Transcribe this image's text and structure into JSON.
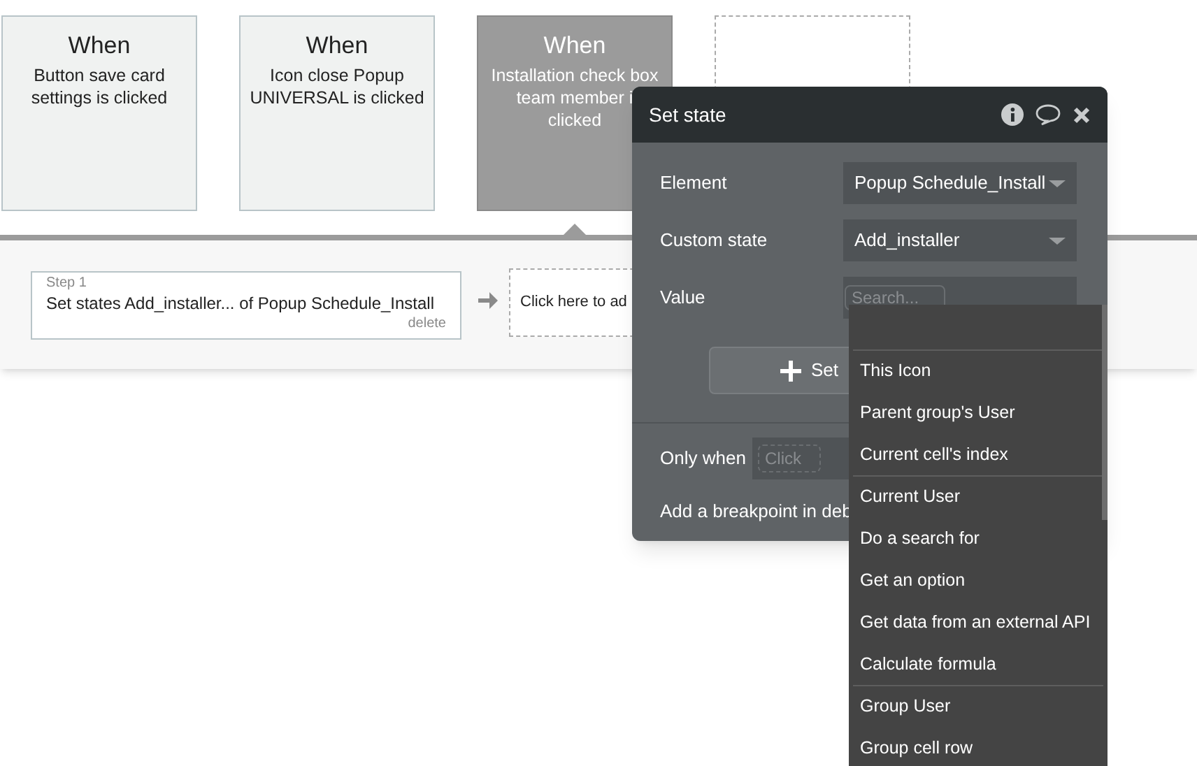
{
  "cards": [
    {
      "kind": "event",
      "title": "When",
      "text": "Button save card settings is clicked",
      "selected": false
    },
    {
      "kind": "event",
      "title": "When",
      "text": "Icon close Popup UNIVERSAL is clicked",
      "selected": false
    },
    {
      "kind": "event",
      "title": "When",
      "lines": [
        "Installation check box",
        "team member i",
        "clicked"
      ],
      "selected": true
    },
    {
      "kind": "empty"
    }
  ],
  "steps": [
    {
      "kind": "action",
      "label": "Step 1",
      "text": "Set states Add_installer... of Popup Schedule_Install",
      "delete": "delete"
    },
    {
      "kind": "add",
      "text": "Click here to ad"
    }
  ],
  "popup": {
    "title": "Set state",
    "fields": [
      {
        "kind": "dropdown",
        "label": "Element",
        "value": "Popup Schedule_Install"
      },
      {
        "kind": "dropdown",
        "label": "Custom state",
        "value": "Add_installer"
      },
      {
        "kind": "search",
        "label": "Value",
        "placeholder": "Search..."
      }
    ],
    "set_button": "Set",
    "only_when": {
      "label": "Only when",
      "placeholder": "Click"
    },
    "breakpoint": "Add a breakpoint in deb"
  },
  "dropdown": {
    "groups": [
      [
        "This Icon",
        "Parent group's User",
        "Current cell's index"
      ],
      [
        "Current User",
        "Do a search for",
        "Get an option",
        "Get data from an external API",
        "Calculate formula"
      ],
      [
        "Group User",
        "Group cell row"
      ]
    ]
  }
}
